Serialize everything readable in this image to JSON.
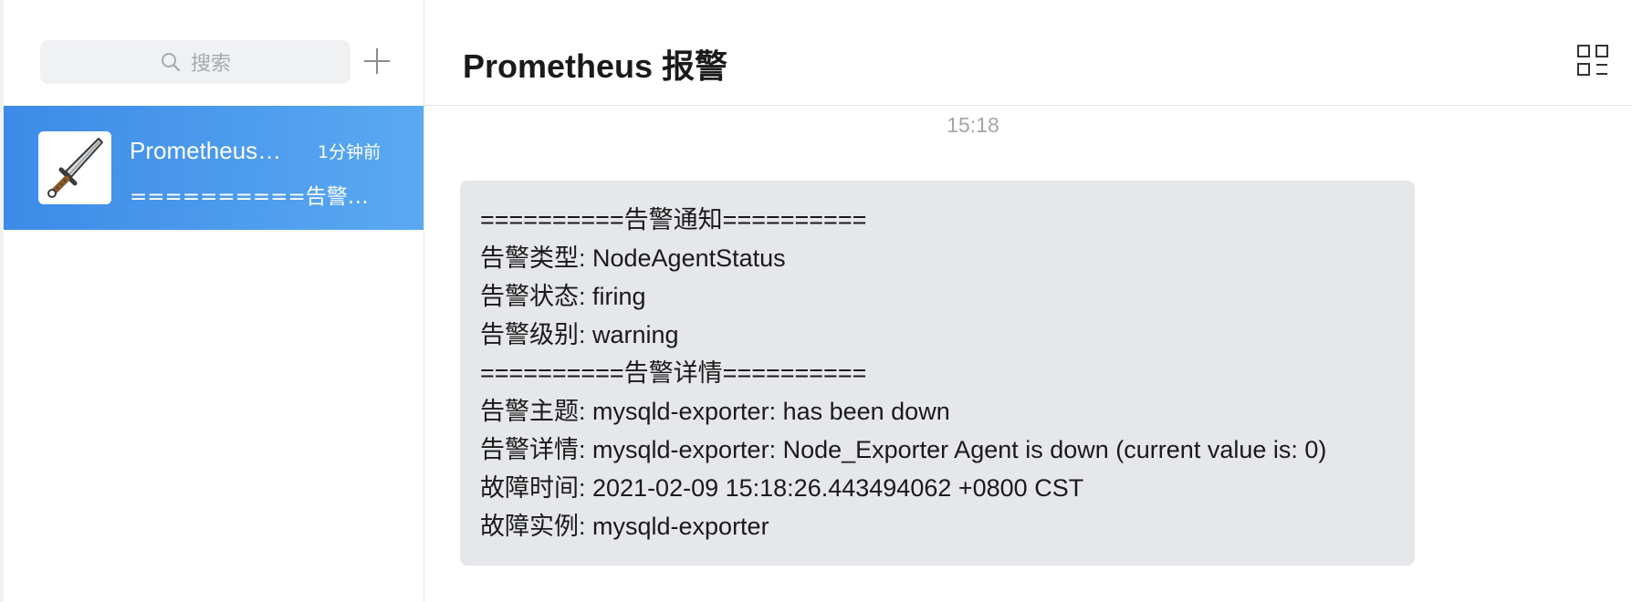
{
  "sidebar": {
    "search": {
      "icon": "search-icon",
      "placeholder": "搜索"
    },
    "add_icon": "plus-icon",
    "conversations": [
      {
        "name": "Prometheus…",
        "time": "1分钟前",
        "preview": "==========告警通知…",
        "avatar_icon": "sword-icon",
        "selected": true
      }
    ]
  },
  "chat": {
    "title": "Prometheus 报警",
    "grid_icon": "grid-menu-icon",
    "timestamp": "15:18",
    "message": {
      "lines": [
        "==========告警通知==========",
        "告警类型: NodeAgentStatus",
        "告警状态: firing",
        "告警级别: warning",
        "==========告警详情==========",
        "告警主题: mysqld-exporter: has been down",
        "告警详情: mysqld-exporter: Node_Exporter Agent is down (current value is: 0)",
        "故障时间: 2021-02-09 15:18:26.443494062 +0800 CST",
        "故障实例: mysqld-exporter"
      ]
    }
  },
  "colors": {
    "selected_gradient_start": "#3d8ae8",
    "selected_gradient_end": "#5aa9f1",
    "bubble_bg": "#e5e7ea",
    "search_bg": "#f0f1f3",
    "timestamp": "#a6a6a6"
  }
}
